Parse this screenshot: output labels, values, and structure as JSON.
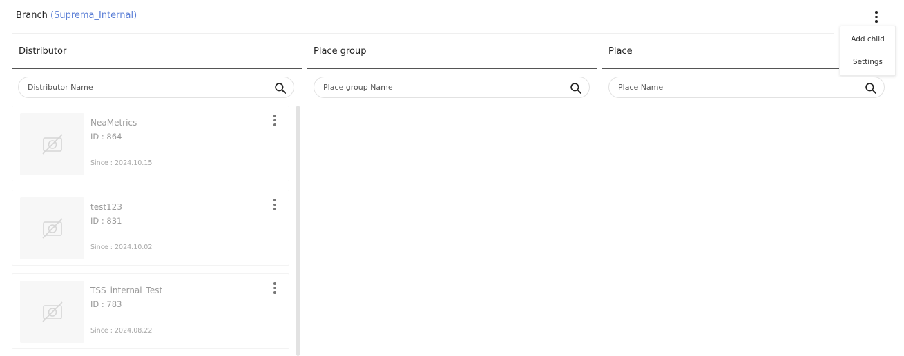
{
  "header": {
    "label": "Branch",
    "org": "(Suprema_Internal)"
  },
  "menu": {
    "items": [
      "Add child",
      "Settings"
    ]
  },
  "columns": [
    {
      "title": "Distributor",
      "search_placeholder": "Distributor Name"
    },
    {
      "title": "Place group",
      "search_placeholder": "Place group Name"
    },
    {
      "title": "Place",
      "search_placeholder": "Place Name"
    }
  ],
  "distributors": [
    {
      "name": "NeaMetrics",
      "id": "ID : 864",
      "since": "Since : 2024.10.15"
    },
    {
      "name": "test123",
      "id": "ID : 831",
      "since": "Since : 2024.10.02"
    },
    {
      "name": "TSS_internal_Test",
      "id": "ID : 783",
      "since": "Since : 2024.08.22"
    }
  ],
  "icons": {
    "more": "more-vertical-icon",
    "search": "search-icon",
    "no_image": "no-image-icon"
  },
  "colors": {
    "accent": "#5b7fd6"
  }
}
